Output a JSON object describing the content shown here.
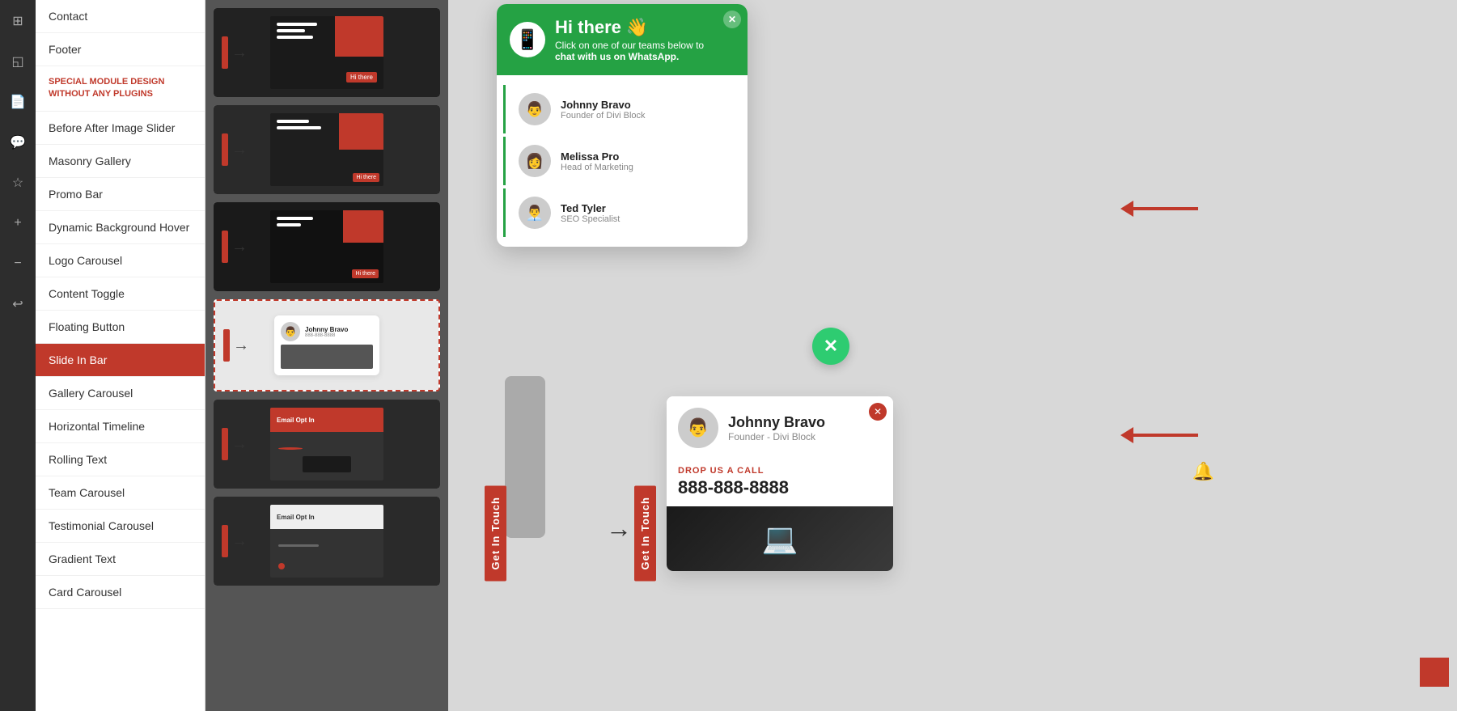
{
  "iconSidebar": {
    "icons": [
      {
        "name": "grid-icon",
        "symbol": "⊞"
      },
      {
        "name": "layers-icon",
        "symbol": "◱"
      },
      {
        "name": "file-icon",
        "symbol": "📄"
      },
      {
        "name": "star-icon",
        "symbol": "☆"
      },
      {
        "name": "plus-icon",
        "symbol": "+"
      },
      {
        "name": "minus-icon",
        "symbol": "−"
      },
      {
        "name": "undo-icon",
        "symbol": "↩"
      }
    ]
  },
  "navSidebar": {
    "specialLabel": "SPECIAL MODULE DESIGN WITHOUT ANY PLUGINS",
    "items": [
      {
        "label": "Contact",
        "active": false
      },
      {
        "label": "Footer",
        "active": false
      },
      {
        "label": "Before After Image Slider",
        "active": false
      },
      {
        "label": "Masonry Gallery",
        "active": false
      },
      {
        "label": "Promo Bar",
        "active": false
      },
      {
        "label": "Dynamic Background Hover",
        "active": false
      },
      {
        "label": "Logo Carousel",
        "active": false
      },
      {
        "label": "Content Toggle",
        "active": false
      },
      {
        "label": "Floating Button",
        "active": false
      },
      {
        "label": "Slide In Bar",
        "active": true
      },
      {
        "label": "Gallery Carousel",
        "active": false
      },
      {
        "label": "Horizontal Timeline",
        "active": false
      },
      {
        "label": "Rolling Text",
        "active": false
      },
      {
        "label": "Team Carousel",
        "active": false
      },
      {
        "label": "Testimonial Carousel",
        "active": false
      },
      {
        "label": "Gradient Text",
        "active": false
      },
      {
        "label": "Card Carousel",
        "active": false
      }
    ]
  },
  "previewCards": [
    {
      "id": 1,
      "selected": false
    },
    {
      "id": 2,
      "selected": false
    },
    {
      "id": 3,
      "selected": false
    },
    {
      "id": 4,
      "selected": true
    },
    {
      "id": 5,
      "selected": false
    },
    {
      "id": 6,
      "selected": false
    }
  ],
  "whatsappPopup": {
    "title": "Hi there",
    "wave": "👋",
    "icon": "📱",
    "subtitle": "Click on one of our teams below to",
    "subtitleBold": "chat with us on WhatsApp.",
    "contacts": [
      {
        "name": "Johnny Bravo",
        "role": "Founder of Divi Block",
        "avatar": "👨"
      },
      {
        "name": "Melissa Pro",
        "role": "Head of Marketing",
        "avatar": "👩"
      },
      {
        "name": "Ted Tyler",
        "role": "SEO Specialist",
        "avatar": "👨‍💼"
      }
    ]
  },
  "floatingCard": {
    "name": "Johnny Bravo",
    "role": "Founder - Divi Block",
    "avatar": "👨",
    "dropUsCallLabel": "DROP US A CALL",
    "phone": "888-888-8888"
  },
  "getInTouchLabel": "Get In Touch",
  "arrows": {
    "redArrowCount": 2,
    "blackArrowSymbol": "→"
  }
}
